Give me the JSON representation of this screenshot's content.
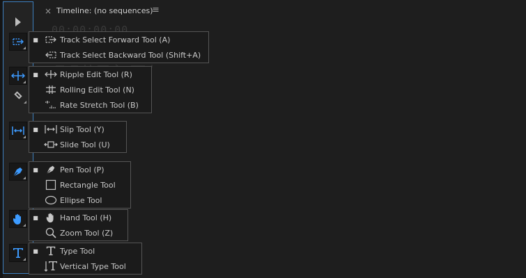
{
  "timeline": {
    "close": "×",
    "title": "Timeline: (no sequences)",
    "menu": "≡",
    "timecode": "00:00:00:00"
  },
  "colors": {
    "accent": "#3d9bff",
    "panel_border": "#3d7fbf",
    "text": "#c8c8c8"
  },
  "toolbar": {
    "buttons": [
      {
        "icon": "selection-arrow-icon"
      },
      {
        "icon": "track-select-forward-icon"
      },
      {
        "icon": "ripple-edit-icon"
      },
      {
        "icon": "razor-icon"
      },
      {
        "icon": "slip-icon"
      },
      {
        "icon": "pen-icon"
      },
      {
        "icon": "hand-icon"
      },
      {
        "icon": "type-icon"
      }
    ]
  },
  "flyouts": [
    {
      "items": [
        {
          "label": "Track Select Forward Tool (A)",
          "icon": "track-select-forward-icon",
          "selected": true
        },
        {
          "label": "Track Select Backward Tool (Shift+A)",
          "icon": "track-select-backward-icon",
          "selected": false
        }
      ]
    },
    {
      "items": [
        {
          "label": "Ripple Edit Tool (R)",
          "icon": "ripple-edit-icon",
          "selected": true
        },
        {
          "label": "Rolling Edit Tool (N)",
          "icon": "rolling-edit-icon",
          "selected": false
        },
        {
          "label": "Rate Stretch Tool (B)",
          "icon": "rate-stretch-icon",
          "selected": false
        }
      ]
    },
    {
      "items": [
        {
          "label": "Slip Tool (Y)",
          "icon": "slip-icon",
          "selected": true
        },
        {
          "label": "Slide Tool (U)",
          "icon": "slide-icon",
          "selected": false
        }
      ]
    },
    {
      "items": [
        {
          "label": "Pen Tool (P)",
          "icon": "pen-icon",
          "selected": true
        },
        {
          "label": "Rectangle Tool",
          "icon": "rectangle-icon",
          "selected": false
        },
        {
          "label": "Ellipse Tool",
          "icon": "ellipse-icon",
          "selected": false
        }
      ]
    },
    {
      "items": [
        {
          "label": "Hand Tool (H)",
          "icon": "hand-icon",
          "selected": true
        },
        {
          "label": "Zoom Tool (Z)",
          "icon": "zoom-icon",
          "selected": false
        }
      ]
    },
    {
      "items": [
        {
          "label": "Type Tool",
          "icon": "type-icon",
          "selected": true
        },
        {
          "label": "Vertical Type Tool",
          "icon": "vertical-type-icon",
          "selected": false
        }
      ]
    }
  ]
}
